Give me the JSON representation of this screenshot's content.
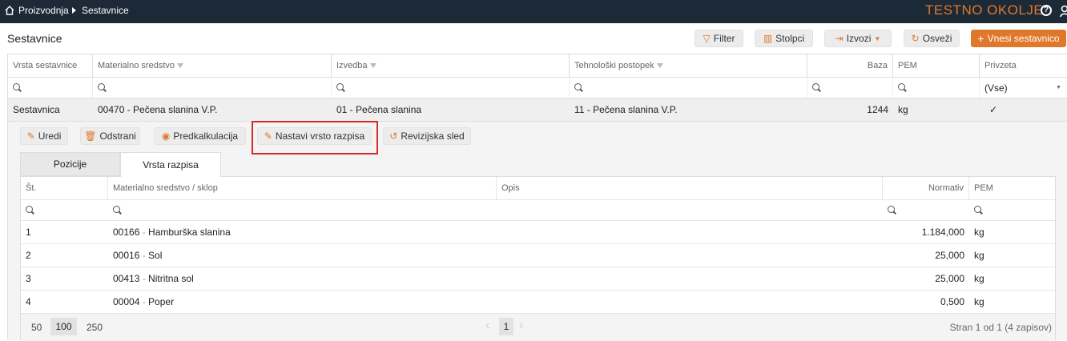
{
  "topbar": {
    "breadcrumb": [
      "Proizvodnja",
      "Sestavnice"
    ],
    "environment": "TESTNO OKOLJE",
    "help_icon": "?",
    "icons": {
      "home": "home-icon",
      "help": "help-icon",
      "user": "user-icon"
    }
  },
  "page": {
    "title": "Sestavnice"
  },
  "toolbar": {
    "filter": "Filter",
    "columns": "Stolpci",
    "exports": "Izvozi",
    "refresh": "Osveži",
    "add": "Vnesi sestavnico"
  },
  "grid": {
    "headers": [
      "Vrsta sestavnice",
      "Materialno sredstvo",
      "Izvedba",
      "Tehnološki postopek",
      "Baza",
      "PEM",
      "Privzeta"
    ],
    "filter_select": "(Vse)",
    "row": {
      "vrsta": "Sestavnica",
      "material": "00470 - Pečena slanina V.P.",
      "izvedba": "01 - Pečena slanina",
      "postopek": "11 - Pečena slanina V.P.",
      "baza": "1244",
      "pem": "kg",
      "privzeta": "✓"
    }
  },
  "detail": {
    "actions": {
      "edit": "Uredi",
      "delete": "Odstrani",
      "precalc": "Predkalkulacija",
      "set_type": "Nastavi vrsto razpisa",
      "revision": "Revizijska sled"
    },
    "tabs": [
      "Pozicije",
      "Vrsta razpisa"
    ],
    "headers": [
      "Št.",
      "Materialno sredstvo / sklop",
      "Opis",
      "Normativ",
      "PEM"
    ],
    "rows": [
      {
        "n": "1",
        "code": "00166",
        "name": "Hamburška slanina",
        "normativ": "1.184,000",
        "pem": "kg"
      },
      {
        "n": "2",
        "code": "00016",
        "name": "Sol",
        "normativ": "25,000",
        "pem": "kg"
      },
      {
        "n": "3",
        "code": "00413",
        "name": "Nitritna sol",
        "normativ": "25,000",
        "pem": "kg"
      },
      {
        "n": "4",
        "code": "00004",
        "name": "Poper",
        "normativ": "0,500",
        "pem": "kg"
      }
    ],
    "pager": {
      "sizes": [
        "50",
        "100",
        "250"
      ],
      "selected_size": "100",
      "current_page": "1",
      "info": "Stran 1 od 1 (4 zapisov)"
    }
  }
}
